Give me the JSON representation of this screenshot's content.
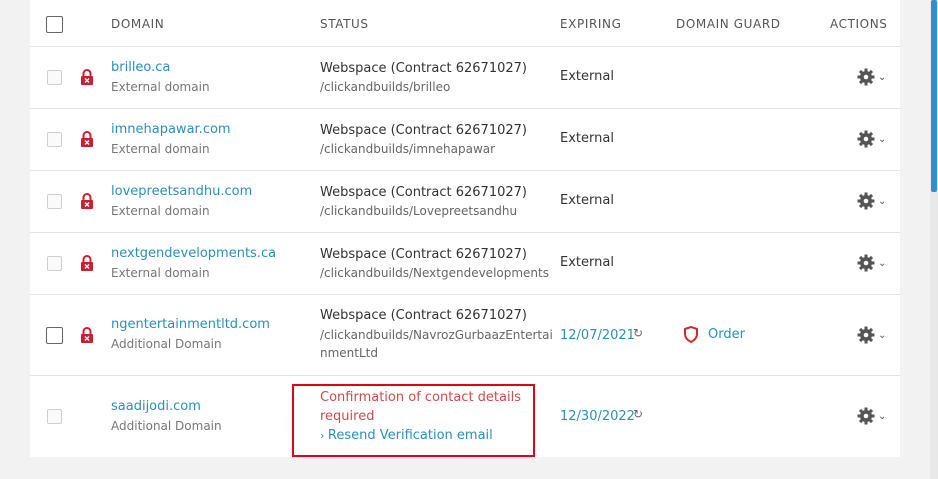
{
  "header": {
    "domain": "DOMAIN",
    "status": "STATUS",
    "expiring": "EXPIRING",
    "domain_guard": "DOMAIN GUARD",
    "actions": "ACTIONS"
  },
  "rows": [
    {
      "domain": "brilleo.ca",
      "type": "External domain",
      "status_line1": "Webspace (Contract 62671027)",
      "status_line2": "/clickandbuilds/brilleo",
      "expiring": "External"
    },
    {
      "domain": "imnehapawar.com",
      "type": "External domain",
      "status_line1": "Webspace (Contract 62671027)",
      "status_line2": "/clickandbuilds/imnehapawar",
      "expiring": "External"
    },
    {
      "domain": "lovepreetsandhu.com",
      "type": "External domain",
      "status_line1": "Webspace (Contract 62671027)",
      "status_line2": "/clickandbuilds/Lovepreetsandhu",
      "expiring": "External"
    },
    {
      "domain": "nextgendevelopments.ca",
      "type": "External domain",
      "status_line1": "Webspace (Contract 62671027)",
      "status_line2": "/clickandbuilds/Nextgendevelopments",
      "expiring": "External"
    },
    {
      "domain": "ngentertainmentltd.com",
      "type": "Additional Domain",
      "status_line1": "Webspace (Contract 62671027)",
      "status_line2a": "/clickandbuilds/NavrozGurbaazEntertai",
      "status_line2b": "nmentLtd",
      "expiring": "12/07/2021",
      "guard": "Order"
    },
    {
      "domain": "saadijodi.com",
      "type": "Additional Domain",
      "warning_line1": "Confirmation of contact details",
      "warning_line2": "required",
      "resend": "Resend Verification email",
      "expiring": "12/30/2022"
    }
  ],
  "colors": {
    "link": "#2a8fbd",
    "warning": "#d24a4a",
    "highlight_box": "#e3001b",
    "lock": "#c8202f"
  },
  "icons": [
    "lock-icon",
    "gear-icon",
    "chevron-down-icon",
    "refresh-icon",
    "shield-icon"
  ]
}
